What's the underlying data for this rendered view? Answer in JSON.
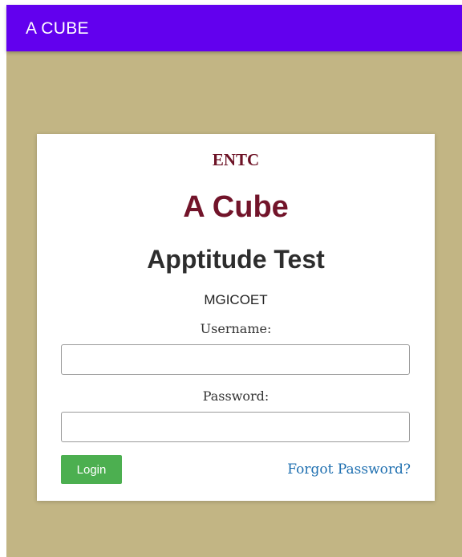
{
  "appbar": {
    "title": "A CUBE"
  },
  "login_card": {
    "department": "ENTC",
    "brand": "A Cube",
    "subtitle": "Apptitude Test",
    "college": "MGICOET",
    "username_label": "Username:",
    "username_value": "",
    "password_label": "Password:",
    "password_value": "",
    "login_button": "Login",
    "forgot_link": "Forgot Password?"
  },
  "colors": {
    "appbar": "#6200ee",
    "background": "#c2b584",
    "brand_text": "#72142a",
    "login_button": "#4caf50",
    "link": "#1e6fb0"
  }
}
